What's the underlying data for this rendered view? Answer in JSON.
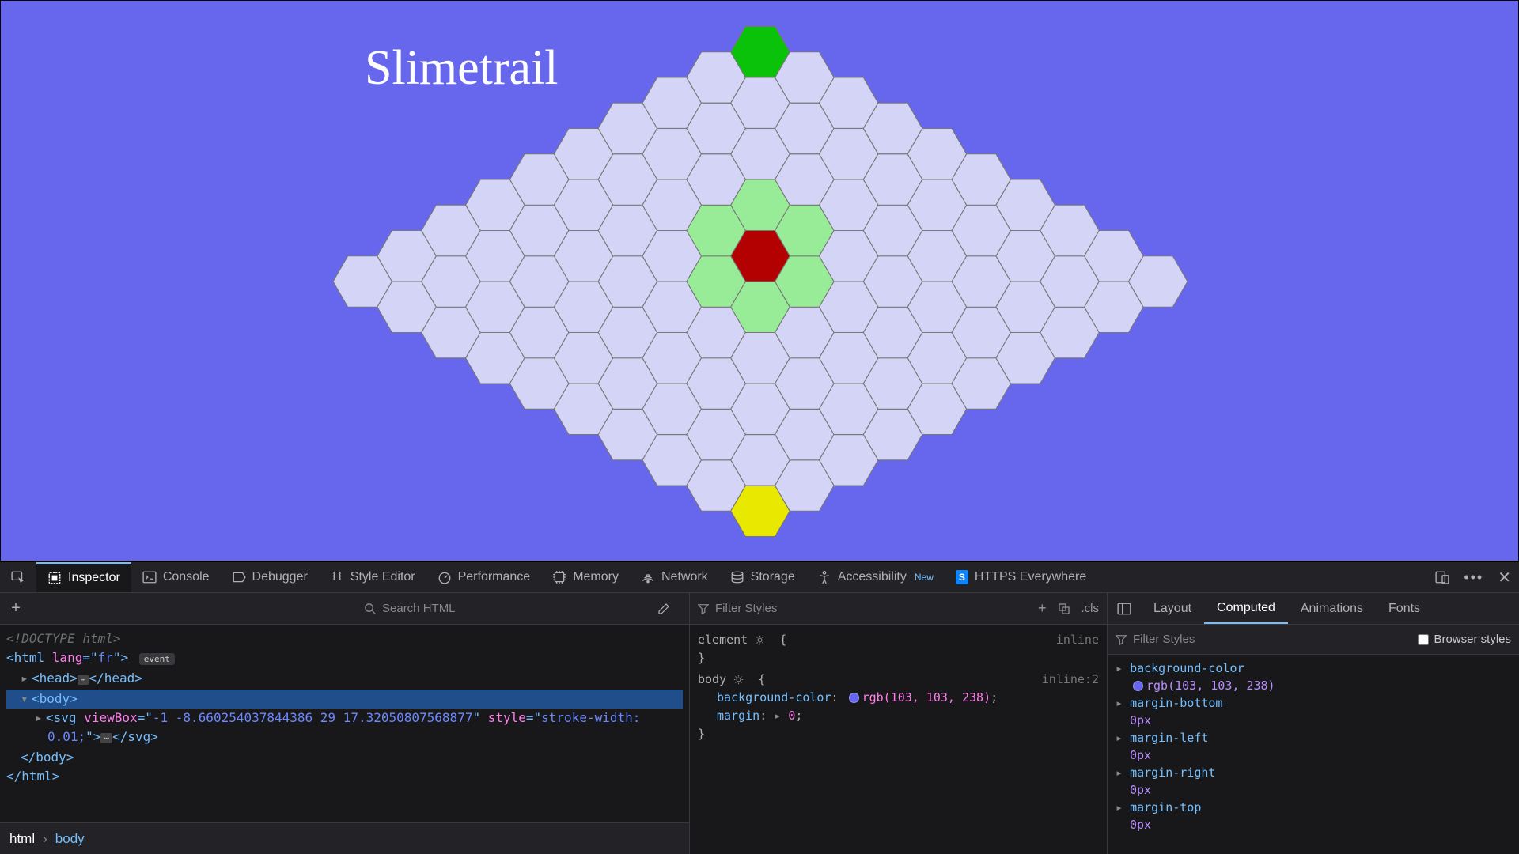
{
  "app": {
    "title": "Slimetrail"
  },
  "hex": {
    "size": 9,
    "colors": {
      "board": "#d4d4f7",
      "stroke": "#777",
      "goal_top": "#0ac20a",
      "goal_bottom": "#e8e800",
      "piece": "#b30000",
      "neighbor": "#98ec98"
    }
  },
  "devtools": {
    "tabs": [
      "Inspector",
      "Console",
      "Debugger",
      "Style Editor",
      "Performance",
      "Memory",
      "Network",
      "Storage",
      "Accessibility"
    ],
    "accessibility_new": "New",
    "extension": "HTTPS Everywhere",
    "search_placeholder": "Search HTML",
    "dom": {
      "doctype": "<!DOCTYPE html>",
      "html_open": "<html lang=\"fr\">",
      "event_label": "event",
      "head": "<head>…</head>",
      "body_open": "<body>",
      "svg_line": "<svg viewBox=\"-1 -8.660254037844386 29 17.32050807568877\" style=\"stroke-width: 0.01;\">…</svg>",
      "body_close": "</body>",
      "html_close": "</html>"
    },
    "rules": {
      "filter_placeholder": "Filter Styles",
      "cls_label": ".cls",
      "element_label": "element",
      "inline_label": "inline",
      "body_label": "body",
      "inline2_label": "inline:2",
      "bg_prop": "background-color",
      "bg_value": "rgb(103, 103, 238)",
      "margin_prop": "margin",
      "margin_value": "0"
    },
    "computed": {
      "tabs": [
        "Layout",
        "Computed",
        "Animations",
        "Fonts"
      ],
      "filter_placeholder": "Filter Styles",
      "browser_styles_label": "Browser styles",
      "props": [
        {
          "name": "background-color",
          "value": "rgb(103, 103, 238)",
          "swatch": "#6767ee"
        },
        {
          "name": "margin-bottom",
          "value": "0px"
        },
        {
          "name": "margin-left",
          "value": "0px"
        },
        {
          "name": "margin-right",
          "value": "0px"
        },
        {
          "name": "margin-top",
          "value": "0px"
        }
      ]
    },
    "breadcrumb": [
      "html",
      "body"
    ]
  }
}
